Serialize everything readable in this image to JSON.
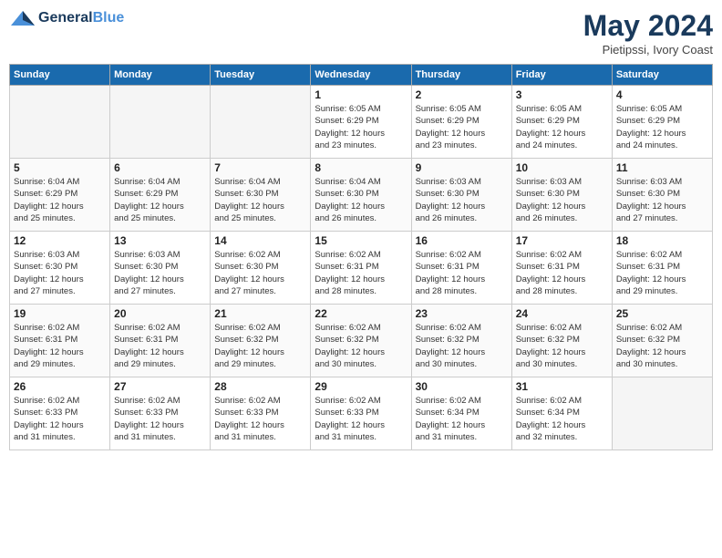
{
  "header": {
    "logo_general": "General",
    "logo_blue": "Blue",
    "month": "May 2024",
    "location": "Pietipssi, Ivory Coast"
  },
  "weekdays": [
    "Sunday",
    "Monday",
    "Tuesday",
    "Wednesday",
    "Thursday",
    "Friday",
    "Saturday"
  ],
  "weeks": [
    [
      {
        "day": "",
        "info": ""
      },
      {
        "day": "",
        "info": ""
      },
      {
        "day": "",
        "info": ""
      },
      {
        "day": "1",
        "info": "Sunrise: 6:05 AM\nSunset: 6:29 PM\nDaylight: 12 hours\nand 23 minutes."
      },
      {
        "day": "2",
        "info": "Sunrise: 6:05 AM\nSunset: 6:29 PM\nDaylight: 12 hours\nand 23 minutes."
      },
      {
        "day": "3",
        "info": "Sunrise: 6:05 AM\nSunset: 6:29 PM\nDaylight: 12 hours\nand 24 minutes."
      },
      {
        "day": "4",
        "info": "Sunrise: 6:05 AM\nSunset: 6:29 PM\nDaylight: 12 hours\nand 24 minutes."
      }
    ],
    [
      {
        "day": "5",
        "info": "Sunrise: 6:04 AM\nSunset: 6:29 PM\nDaylight: 12 hours\nand 25 minutes."
      },
      {
        "day": "6",
        "info": "Sunrise: 6:04 AM\nSunset: 6:29 PM\nDaylight: 12 hours\nand 25 minutes."
      },
      {
        "day": "7",
        "info": "Sunrise: 6:04 AM\nSunset: 6:30 PM\nDaylight: 12 hours\nand 25 minutes."
      },
      {
        "day": "8",
        "info": "Sunrise: 6:04 AM\nSunset: 6:30 PM\nDaylight: 12 hours\nand 26 minutes."
      },
      {
        "day": "9",
        "info": "Sunrise: 6:03 AM\nSunset: 6:30 PM\nDaylight: 12 hours\nand 26 minutes."
      },
      {
        "day": "10",
        "info": "Sunrise: 6:03 AM\nSunset: 6:30 PM\nDaylight: 12 hours\nand 26 minutes."
      },
      {
        "day": "11",
        "info": "Sunrise: 6:03 AM\nSunset: 6:30 PM\nDaylight: 12 hours\nand 27 minutes."
      }
    ],
    [
      {
        "day": "12",
        "info": "Sunrise: 6:03 AM\nSunset: 6:30 PM\nDaylight: 12 hours\nand 27 minutes."
      },
      {
        "day": "13",
        "info": "Sunrise: 6:03 AM\nSunset: 6:30 PM\nDaylight: 12 hours\nand 27 minutes."
      },
      {
        "day": "14",
        "info": "Sunrise: 6:02 AM\nSunset: 6:30 PM\nDaylight: 12 hours\nand 27 minutes."
      },
      {
        "day": "15",
        "info": "Sunrise: 6:02 AM\nSunset: 6:31 PM\nDaylight: 12 hours\nand 28 minutes."
      },
      {
        "day": "16",
        "info": "Sunrise: 6:02 AM\nSunset: 6:31 PM\nDaylight: 12 hours\nand 28 minutes."
      },
      {
        "day": "17",
        "info": "Sunrise: 6:02 AM\nSunset: 6:31 PM\nDaylight: 12 hours\nand 28 minutes."
      },
      {
        "day": "18",
        "info": "Sunrise: 6:02 AM\nSunset: 6:31 PM\nDaylight: 12 hours\nand 29 minutes."
      }
    ],
    [
      {
        "day": "19",
        "info": "Sunrise: 6:02 AM\nSunset: 6:31 PM\nDaylight: 12 hours\nand 29 minutes."
      },
      {
        "day": "20",
        "info": "Sunrise: 6:02 AM\nSunset: 6:31 PM\nDaylight: 12 hours\nand 29 minutes."
      },
      {
        "day": "21",
        "info": "Sunrise: 6:02 AM\nSunset: 6:32 PM\nDaylight: 12 hours\nand 29 minutes."
      },
      {
        "day": "22",
        "info": "Sunrise: 6:02 AM\nSunset: 6:32 PM\nDaylight: 12 hours\nand 30 minutes."
      },
      {
        "day": "23",
        "info": "Sunrise: 6:02 AM\nSunset: 6:32 PM\nDaylight: 12 hours\nand 30 minutes."
      },
      {
        "day": "24",
        "info": "Sunrise: 6:02 AM\nSunset: 6:32 PM\nDaylight: 12 hours\nand 30 minutes."
      },
      {
        "day": "25",
        "info": "Sunrise: 6:02 AM\nSunset: 6:32 PM\nDaylight: 12 hours\nand 30 minutes."
      }
    ],
    [
      {
        "day": "26",
        "info": "Sunrise: 6:02 AM\nSunset: 6:33 PM\nDaylight: 12 hours\nand 31 minutes."
      },
      {
        "day": "27",
        "info": "Sunrise: 6:02 AM\nSunset: 6:33 PM\nDaylight: 12 hours\nand 31 minutes."
      },
      {
        "day": "28",
        "info": "Sunrise: 6:02 AM\nSunset: 6:33 PM\nDaylight: 12 hours\nand 31 minutes."
      },
      {
        "day": "29",
        "info": "Sunrise: 6:02 AM\nSunset: 6:33 PM\nDaylight: 12 hours\nand 31 minutes."
      },
      {
        "day": "30",
        "info": "Sunrise: 6:02 AM\nSunset: 6:34 PM\nDaylight: 12 hours\nand 31 minutes."
      },
      {
        "day": "31",
        "info": "Sunrise: 6:02 AM\nSunset: 6:34 PM\nDaylight: 12 hours\nand 32 minutes."
      },
      {
        "day": "",
        "info": ""
      }
    ]
  ]
}
